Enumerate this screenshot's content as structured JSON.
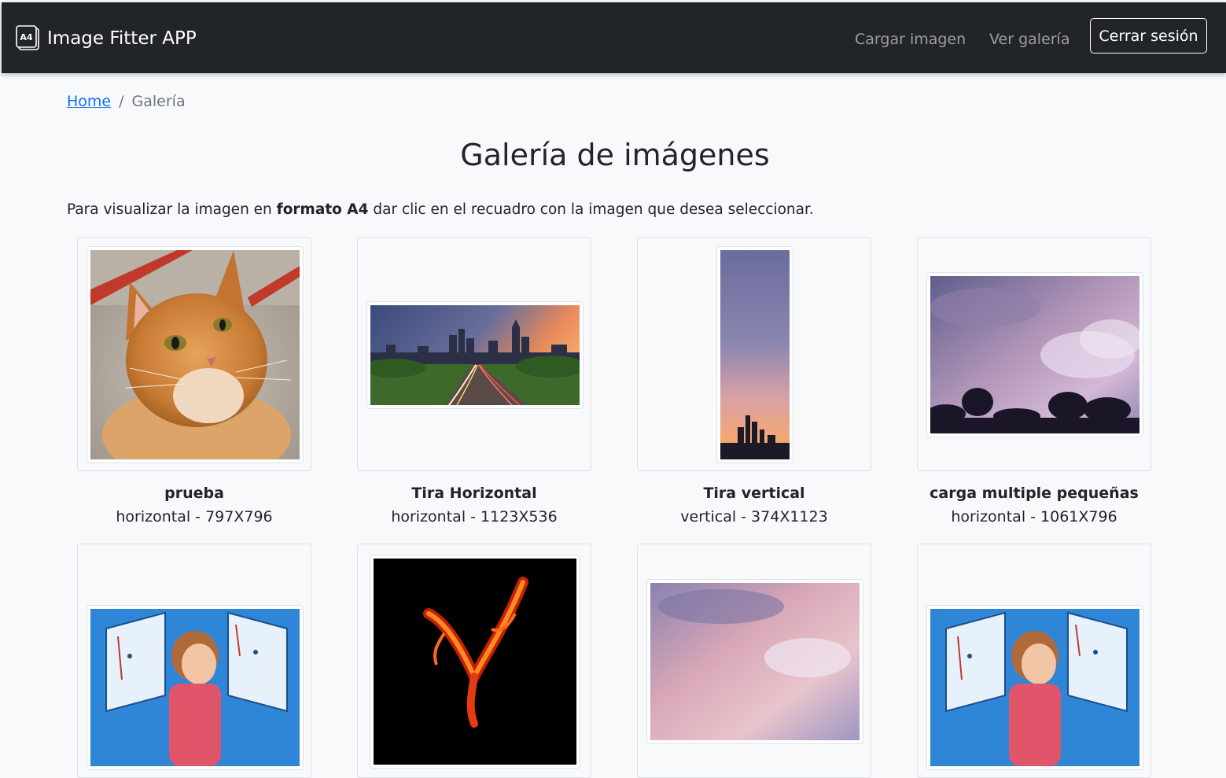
{
  "navbar": {
    "brand_icon_text": "A4",
    "brand": "Image Fitter APP",
    "links": [
      "Cargar imagen",
      "Ver galería"
    ],
    "logout": "Cerrar sesión"
  },
  "breadcrumb": {
    "home": "Home",
    "separator": "/",
    "current": "Galería"
  },
  "page": {
    "title": "Galería de imágenes",
    "intro_before": "Para visualizar la imagen en ",
    "intro_bold": "formato A4",
    "intro_after": " dar clic en el recuadro con la imagen que desea seleccionar."
  },
  "gallery": [
    {
      "name": "prueba",
      "meta": "horizontal - 797X796",
      "image": "orange-cat"
    },
    {
      "name": "Tira Horizontal",
      "meta": "horizontal - 1123X536",
      "image": "city-skyline-highway"
    },
    {
      "name": "Tira vertical",
      "meta": "vertical - 374X1123",
      "image": "sunset-skyline-strip"
    },
    {
      "name": "carga multiple pequeñas",
      "meta": "horizontal - 1061X796",
      "image": "purple-clouds"
    },
    {
      "image": "programmer-illustration"
    },
    {
      "image": "fire-letter-v"
    },
    {
      "image": "pink-clouds"
    },
    {
      "image": "programmer-illustration"
    }
  ],
  "colors": {
    "navbar": "#212529",
    "link": "#0d6efd",
    "muted": "#6c757d",
    "background": "#f8f9fa"
  }
}
